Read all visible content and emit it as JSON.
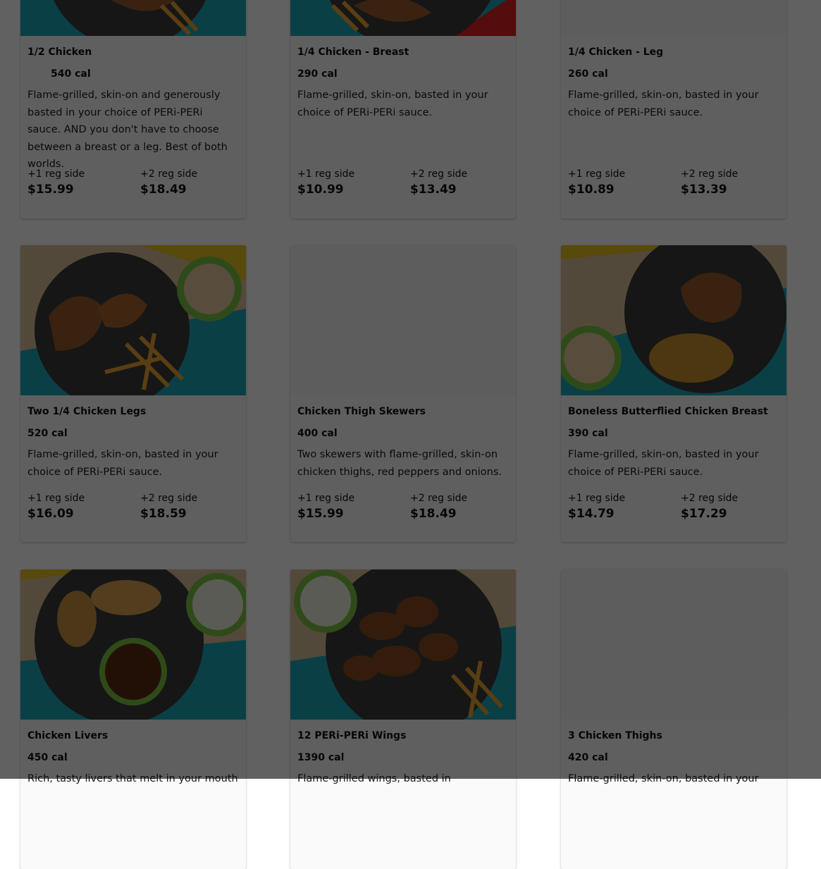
{
  "menu": {
    "items": [
      {
        "title": "1/2 Chicken",
        "calories": "540 cal",
        "description": "Flame-grilled, skin-on and generously basted in your choice of PERi-PERi sauce. AND you don't have to choose between a breast or a leg. Best of both worlds.",
        "option1_label": "+1 reg side",
        "option1_price": "$15.99",
        "option2_label": "+2 reg side",
        "option2_price": "$18.49",
        "image": "plate-chicken-fries"
      },
      {
        "title": "1/4 Chicken - Breast",
        "calories": "290 cal",
        "description": "Flame-grilled, skin-on, basted in your choice of PERi-PERi sauce.",
        "option1_label": "+1 reg side",
        "option1_price": "$10.99",
        "option2_label": "+2 reg side",
        "option2_price": "$13.49",
        "image": "plate-chicken-fries"
      },
      {
        "title": "1/4 Chicken - Leg",
        "calories": "260 cal",
        "description": "Flame-grilled, skin-on, basted in your choice of PERi-PERi sauce.",
        "option1_label": "+1 reg side",
        "option1_price": "$10.89",
        "option2_label": "+2 reg side",
        "option2_price": "$13.39",
        "image": "none"
      },
      {
        "title": "Two 1/4 Chicken Legs",
        "calories": "520 cal",
        "description": "Flame-grilled, skin-on, basted in your choice of PERi-PERi sauce.",
        "option1_label": "+1 reg side",
        "option1_price": "$16.09",
        "option2_label": "+2 reg side",
        "option2_price": "$18.59",
        "image": "plate-chicken-legs-fries-mac"
      },
      {
        "title": "Chicken Thigh Skewers",
        "calories": "400 cal",
        "description": "Two skewers with flame-grilled, skin-on chicken thighs, red peppers and onions.",
        "option1_label": "+1 reg side",
        "option1_price": "$15.99",
        "option2_label": "+2 reg side",
        "option2_price": "$18.49",
        "image": "none"
      },
      {
        "title": "Boneless Butterflied Chicken Breast",
        "calories": "390 cal",
        "description": "Flame-grilled, skin-on, basted in your choice of PERi-PERi sauce.",
        "option1_label": "+1 reg side",
        "option1_price": "$14.79",
        "option2_label": "+2 reg side",
        "option2_price": "$17.29",
        "image": "plate-chicken-breast-rice"
      },
      {
        "title": "Chicken Livers",
        "calories": "450 cal",
        "description": "Rich, tasty livers that melt in your mouth",
        "image": "plate-livers-bread-slaw"
      },
      {
        "title": "12 PERi-PERi Wings",
        "calories": "1390 cal",
        "description": "Flame-grilled wings, basted in",
        "image": "plate-wings-fries-slaw"
      },
      {
        "title": "3 Chicken Thighs",
        "calories": "420 cal",
        "description": "Flame-grilled, skin-on, basted in your",
        "image": "none"
      }
    ]
  },
  "colors": {
    "overlay": "rgba(0,0,0,0.62)",
    "teal": "#1ea5b8",
    "plate": "#3a3a3c",
    "chicken": "#9a5a2a",
    "fries": "#e8a232",
    "bowl": "#7cc242"
  }
}
